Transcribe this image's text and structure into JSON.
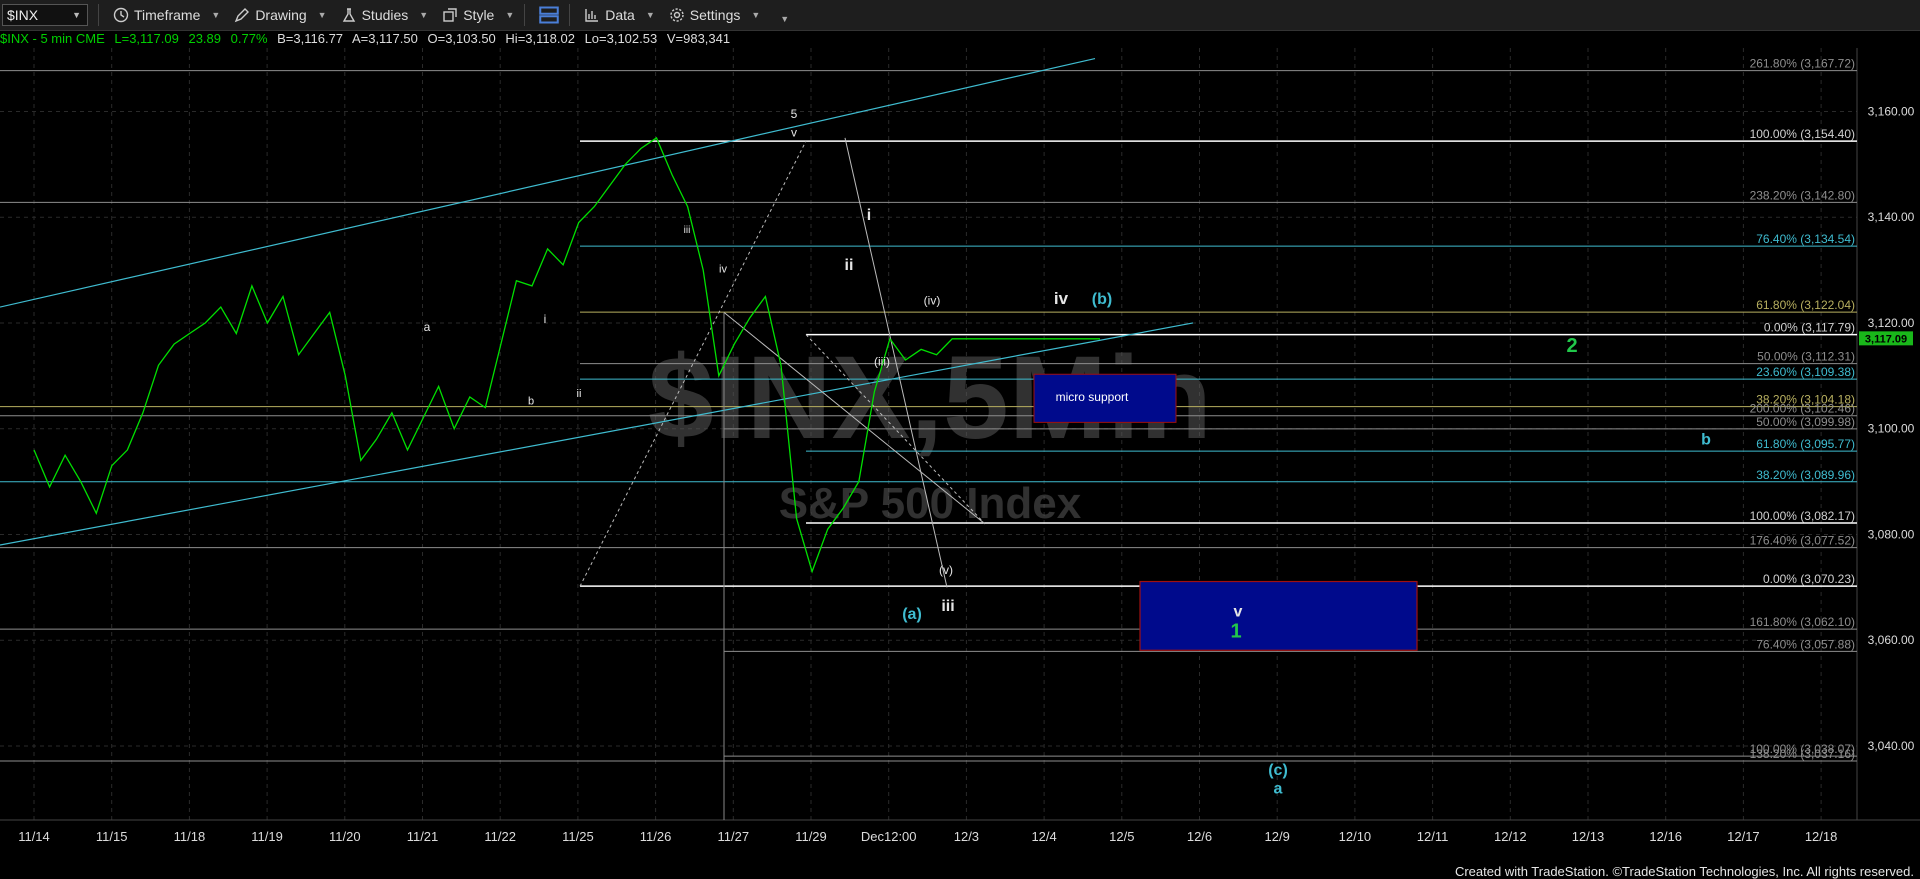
{
  "toolbar": {
    "symbol": "$INX",
    "timeframe": "Timeframe",
    "drawing": "Drawing",
    "studies": "Studies",
    "style": "Style",
    "data": "Data",
    "settings": "Settings"
  },
  "infobar": {
    "symbol": "$INX - 5 min  CME",
    "last": "L=3,117.09",
    "change": "23.89",
    "pct": "0.77%",
    "bid": "B=3,116.77",
    "ask": "A=3,117.50",
    "open": "O=3,103.50",
    "high": "Hi=3,118.02",
    "low": "Lo=3,102.53",
    "volume": "V=983,341"
  },
  "footer": "Created with TradeStation. ©TradeStation Technologies, Inc. All rights reserved.",
  "colors": {
    "price": "#00e000",
    "cyan": "#3fbcd0",
    "grid": "#2a2a2a",
    "fib": "#8e8e8e",
    "white": "#ffffff",
    "green_label": "#21c84a",
    "box": "#000a8c",
    "box_border": "#a01010",
    "last_price_tag": "#19b81a"
  },
  "chart_data": {
    "type": "line",
    "watermark": [
      "$INX,5Min",
      "S&P 500 Index"
    ],
    "x_ticks": [
      "11/14",
      "11/15",
      "11/18",
      "11/19",
      "11/20",
      "11/21",
      "11/22",
      "11/25",
      "11/26",
      "11/27",
      "11/29",
      "Dec12:00",
      "12/3",
      "12/4",
      "12/5",
      "12/6",
      "12/9",
      "12/10",
      "12/11",
      "12/12",
      "12/13",
      "12/16",
      "12/17",
      "12/18"
    ],
    "ylim": [
      3026,
      3172
    ],
    "y_ticks": [
      3040,
      3060,
      3080,
      3100,
      3120,
      3140,
      3160
    ],
    "y_tick_labels": [
      "3,040.00",
      "3,060.00",
      "3,080.00",
      "3,100.00",
      "3,120.00",
      "3,140.00",
      "3,160.00"
    ],
    "last_price": "3,117.09",
    "series": [
      {
        "x": [
          0,
          0.2,
          0.4,
          0.6,
          0.8,
          1.0,
          1.2,
          1.4,
          1.6,
          1.8,
          2.0,
          2.2,
          2.4,
          2.6,
          2.8,
          3.0,
          3.2,
          3.4,
          3.6,
          3.8,
          4.0,
          4.2,
          4.4,
          4.6,
          4.8,
          5.0,
          5.2,
          5.4,
          5.6,
          5.8,
          6.0,
          6.2,
          6.4,
          6.6,
          6.8,
          7.0,
          7.2,
          7.4,
          7.6,
          7.8,
          8.0,
          8.2,
          8.4,
          8.6,
          8.8,
          9.0,
          9.2,
          9.4,
          9.6,
          9.8,
          10.0,
          10.2,
          10.4,
          10.6,
          10.8,
          11.0,
          11.2,
          11.4,
          11.6,
          11.8,
          12.0,
          12.2,
          12.4,
          12.6,
          12.8,
          13.0,
          13.2,
          13.4,
          13.6,
          13.7
        ],
        "values": [
          3096,
          3089,
          3095,
          3090,
          3084,
          3093,
          3096,
          3103,
          3112,
          3116,
          3118,
          3120,
          3123,
          3118,
          3127,
          3120,
          3125,
          3114,
          3118,
          3122,
          3110,
          3094,
          3098,
          3103,
          3096,
          3102,
          3108,
          3100,
          3106,
          3104,
          3116,
          3128,
          3127,
          3134,
          3131,
          3139,
          3142,
          3146,
          3150,
          3153,
          3155,
          3148,
          3142,
          3130,
          3110,
          3116,
          3121,
          3125,
          3112,
          3083,
          3073,
          3081,
          3085,
          3090,
          3107,
          3117,
          3113,
          3115,
          3114,
          3117,
          3117,
          3117,
          3117,
          3117,
          3117,
          3117,
          3117,
          3117,
          3117,
          3117
        ],
        "x_range": [
          0,
          13.7
        ]
      }
    ],
    "fib_levels": [
      {
        "label": "261.80% (3,167.72)",
        "value": 3167.72
      },
      {
        "label": "100.00% (3,154.40)",
        "value": 3154.4
      },
      {
        "label": "238.20% (3,142.80)",
        "value": 3142.8
      },
      {
        "label": "76.40% (3,134.54)",
        "value": 3134.54
      },
      {
        "label": "61.80% (3,122.04)",
        "value": 3122.04
      },
      {
        "label": "0.00% (3,117.79)",
        "value": 3117.79
      },
      {
        "label": "50.00% (3,112.31)",
        "value": 3112.31
      },
      {
        "label": "23.60% (3,109.38)",
        "value": 3109.38
      },
      {
        "label": "38.20% (3,104.18)",
        "value": 3104.18
      },
      {
        "label": "200.00% (3,102.46)",
        "value": 3102.46
      },
      {
        "label": "50.00% (3,099.98)",
        "value": 3099.98
      },
      {
        "label": "61.80% (3,095.77)",
        "value": 3095.77
      },
      {
        "label": "38.20% (3,089.96)",
        "value": 3089.96
      },
      {
        "label": "100.00% (3,082.17)",
        "value": 3082.17
      },
      {
        "label": "176.40% (3,077.52)",
        "value": 3077.52
      },
      {
        "label": "0.00% (3,070.23)",
        "value": 3070.23
      },
      {
        "label": "161.80% (3,062.10)",
        "value": 3062.1
      },
      {
        "label": "76.40% (3,057.88)",
        "value": 3057.88
      },
      {
        "label": "100.00% (3,038.07)",
        "value": 3038.07
      },
      {
        "label": "138.20% (3,037.16)",
        "value": 3037.16
      }
    ],
    "annotations": {
      "micro_support": "micro support",
      "wave_labels_white": [
        "5",
        "v",
        "iii",
        "iv",
        "a",
        "b",
        "i",
        "ii",
        "i",
        "ii",
        "(iv)",
        "(iii)",
        "(v)",
        "iii",
        "iv",
        "v"
      ],
      "wave_labels_cyan": [
        "(b)",
        "(a)",
        "b",
        "(c)",
        "a"
      ],
      "wave_labels_green": [
        "2",
        "1"
      ]
    }
  }
}
